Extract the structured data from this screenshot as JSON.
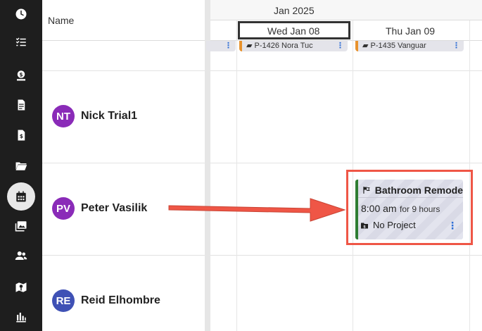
{
  "sidebar": {
    "icons": [
      "clock-icon",
      "task-list-icon",
      "invoice-dollar-icon",
      "document-icon",
      "dollar-document-icon",
      "folder-icon",
      "calendar-icon",
      "photos-icon",
      "team-icon",
      "map-icon",
      "reports-icon"
    ],
    "active": "calendar-icon"
  },
  "name_column": {
    "header": "Name"
  },
  "timeline": {
    "month": "Jan 2025",
    "days": [
      {
        "label": "Wed Jan 08",
        "highlighted": true
      },
      {
        "label": "Thu Jan 09",
        "highlighted": false
      }
    ]
  },
  "top_chips": [
    {
      "text": "P-1426 Nora Tuc"
    },
    {
      "text": "P-1435 Vanguar"
    }
  ],
  "people": [
    {
      "initials": "NT",
      "name": "Nick Trial1",
      "color": "#8a2bb8"
    },
    {
      "initials": "PV",
      "name": "Peter Vasilik",
      "color": "#8a2bb8"
    },
    {
      "initials": "RE",
      "name": "Reid Elhombre",
      "color": "#3f51b5"
    }
  ],
  "event_card": {
    "title": "Bathroom Remode",
    "time": "8:00 am",
    "duration": "for 9 hours",
    "project": "No Project",
    "bar_color": "#2e7d32"
  },
  "annotation": {
    "color": "#ef5646"
  }
}
